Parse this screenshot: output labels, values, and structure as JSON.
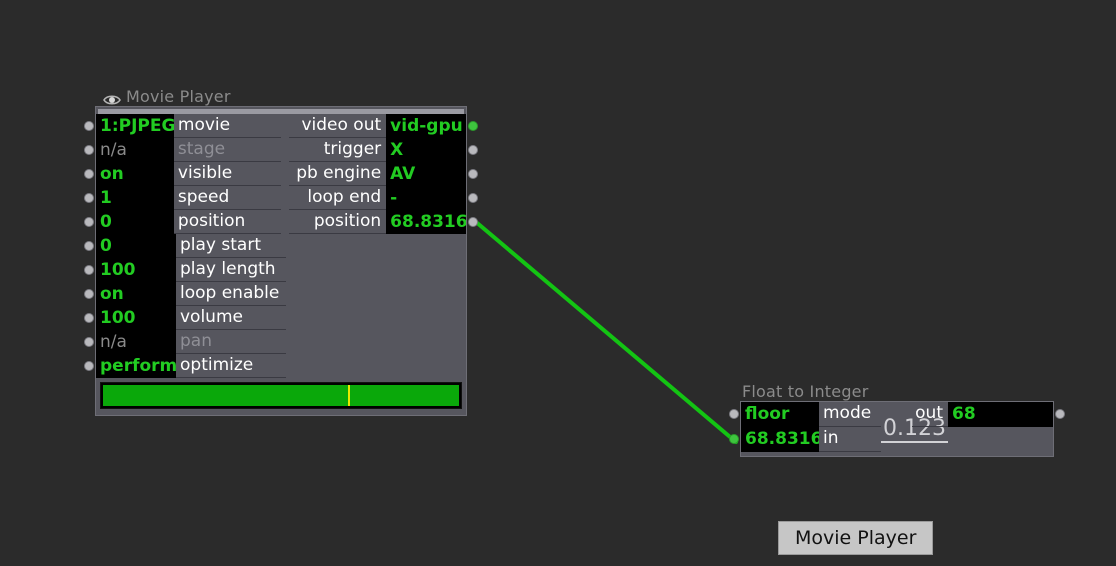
{
  "canvas": {
    "background": "#2b2b2b"
  },
  "colors": {
    "node_body": "#56565e",
    "value_text": "#22cc22",
    "value_bg": "#000000",
    "label_text": "#ffffff",
    "title_text": "#8b8b8b",
    "wire": "#13c413",
    "progress_fill": "#0aa80a",
    "progress_marker": "#e8e800",
    "port": "#b9b9bd",
    "port_active": "#3ec43e"
  },
  "movie_player": {
    "title": "Movie Player",
    "visibility_icon": "eye-icon",
    "inputs": [
      {
        "value": "1:PJPEG",
        "label": "movie",
        "dim_value": false,
        "dim_label": false
      },
      {
        "value": "n/a",
        "label": "stage",
        "dim_value": true,
        "dim_label": true
      },
      {
        "value": "on",
        "label": "visible",
        "dim_value": false,
        "dim_label": false
      },
      {
        "value": "1",
        "label": "speed",
        "dim_value": false,
        "dim_label": false
      },
      {
        "value": "0",
        "label": "position",
        "dim_value": false,
        "dim_label": false
      },
      {
        "value": "0",
        "label": "play start",
        "dim_value": false,
        "dim_label": false
      },
      {
        "value": "100",
        "label": "play length",
        "dim_value": false,
        "dim_label": false
      },
      {
        "value": "on",
        "label": "loop enable",
        "dim_value": false,
        "dim_label": false
      },
      {
        "value": "100",
        "label": "volume",
        "dim_value": false,
        "dim_label": false
      },
      {
        "value": "n/a",
        "label": "pan",
        "dim_value": true,
        "dim_label": true
      },
      {
        "value": "performance",
        "label": "optimize",
        "dim_value": false,
        "dim_label": false
      }
    ],
    "outputs": [
      {
        "label": "video out",
        "value": "vid-gpu",
        "port_active": true
      },
      {
        "label": "trigger",
        "value": "X",
        "port_active": false
      },
      {
        "label": "pb engine",
        "value": "AV",
        "port_active": false
      },
      {
        "label": "loop end",
        "value": "-",
        "port_active": false
      },
      {
        "label": "position",
        "value": "68.8316",
        "port_active": false
      }
    ],
    "progress": {
      "percent": 68.8,
      "marker_percent": 68.8
    }
  },
  "float_to_integer": {
    "title": "Float to Integer",
    "glyph": "0.123",
    "inputs": [
      {
        "value": "floor",
        "label": "mode"
      },
      {
        "value": "68.8316",
        "label": "in"
      }
    ],
    "outputs": [
      {
        "label": "out",
        "value": "68"
      }
    ]
  },
  "tooltip": {
    "text": "Movie Player"
  }
}
